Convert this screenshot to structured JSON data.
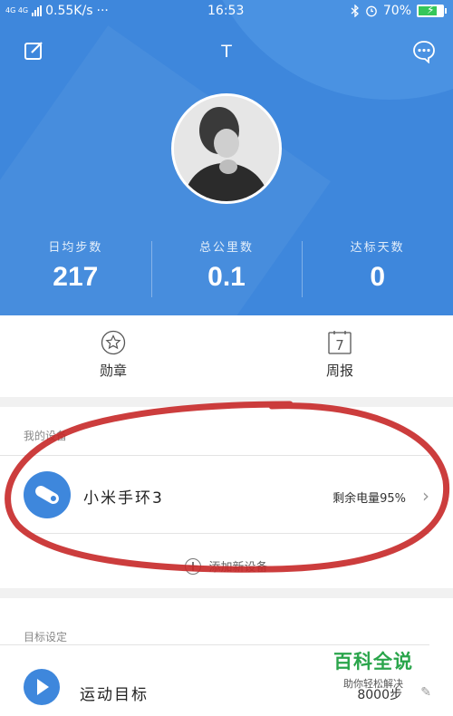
{
  "status_bar": {
    "network_type": "4G 4G",
    "speed": "0.55K/s",
    "dots": "···",
    "time": "16:53",
    "battery_percent": "70%",
    "battery_level": 0.7,
    "icons": [
      "signal-icon",
      "bluetooth-icon",
      "alarm-icon",
      "battery-icon"
    ]
  },
  "header": {
    "title": "T",
    "edit_icon": "edit-icon",
    "chat_icon": "chat-icon",
    "accent_color": "#3e87dc"
  },
  "stats": [
    {
      "label": "日均步数",
      "value": "217"
    },
    {
      "label": "总公里数",
      "value": "0.1"
    },
    {
      "label": "达标天数",
      "value": "0"
    }
  ],
  "quick_actions": [
    {
      "label": "勋章",
      "icon": "star-icon"
    },
    {
      "label": "周报",
      "icon": "calendar-icon",
      "icon_text": "7"
    }
  ],
  "devices": {
    "section_title": "我的设备",
    "items": [
      {
        "name": "小米手环3",
        "battery_text": "剩余电量95%",
        "icon": "band-icon"
      }
    ],
    "add_label": "添加新设备"
  },
  "goals": {
    "section_title": "目标设定",
    "items": [
      {
        "name": "运动目标",
        "value": "8000步",
        "icon": "flag-icon"
      }
    ]
  },
  "watermark": {
    "main": "百科全说",
    "sub": "助你轻松解决"
  }
}
